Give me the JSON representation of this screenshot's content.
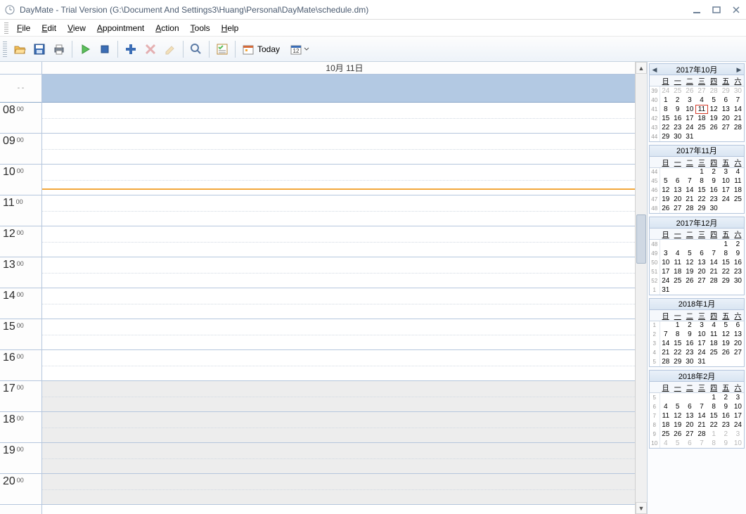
{
  "window": {
    "title": "DayMate - Trial Version (G:\\Document And Settings3\\Huang\\Personal\\DayMate\\schedule.dm)"
  },
  "menu": {
    "items": [
      "File",
      "Edit",
      "View",
      "Appointment",
      "Action",
      "Tools",
      "Help"
    ]
  },
  "toolbar": {
    "today_label": "Today"
  },
  "schedule": {
    "date_header": "10月 11日",
    "hours": [
      "08",
      "09",
      "10",
      "11",
      "12",
      "13",
      "14",
      "15",
      "16",
      "17",
      "18",
      "19",
      "20"
    ],
    "minute_label": "00",
    "shade_after_index": 9
  },
  "dow_labels": [
    "日",
    "一",
    "二",
    "三",
    "四",
    "五",
    "六"
  ],
  "calendars": [
    {
      "title": "2017年10月",
      "has_nav": true,
      "week_nums": [
        "39",
        "40",
        "41",
        "42",
        "43",
        "44"
      ],
      "rows": [
        [
          {
            "d": "24",
            "dim": true
          },
          {
            "d": "25",
            "dim": true
          },
          {
            "d": "26",
            "dim": true
          },
          {
            "d": "27",
            "dim": true
          },
          {
            "d": "28",
            "dim": true
          },
          {
            "d": "29",
            "dim": true
          },
          {
            "d": "30",
            "dim": true
          }
        ],
        [
          {
            "d": "1"
          },
          {
            "d": "2"
          },
          {
            "d": "3"
          },
          {
            "d": "4"
          },
          {
            "d": "5"
          },
          {
            "d": "6"
          },
          {
            "d": "7"
          }
        ],
        [
          {
            "d": "8"
          },
          {
            "d": "9"
          },
          {
            "d": "10"
          },
          {
            "d": "11",
            "today": true
          },
          {
            "d": "12"
          },
          {
            "d": "13"
          },
          {
            "d": "14"
          }
        ],
        [
          {
            "d": "15"
          },
          {
            "d": "16"
          },
          {
            "d": "17"
          },
          {
            "d": "18"
          },
          {
            "d": "19"
          },
          {
            "d": "20"
          },
          {
            "d": "21"
          }
        ],
        [
          {
            "d": "22"
          },
          {
            "d": "23"
          },
          {
            "d": "24"
          },
          {
            "d": "25"
          },
          {
            "d": "26"
          },
          {
            "d": "27"
          },
          {
            "d": "28"
          }
        ],
        [
          {
            "d": "29"
          },
          {
            "d": "30"
          },
          {
            "d": "31"
          },
          {
            "d": ""
          },
          {
            "d": ""
          },
          {
            "d": ""
          },
          {
            "d": ""
          }
        ]
      ]
    },
    {
      "title": "2017年11月",
      "has_nav": false,
      "week_nums": [
        "44",
        "45",
        "46",
        "47",
        "48"
      ],
      "rows": [
        [
          {
            "d": ""
          },
          {
            "d": ""
          },
          {
            "d": ""
          },
          {
            "d": "1"
          },
          {
            "d": "2"
          },
          {
            "d": "3"
          },
          {
            "d": "4"
          }
        ],
        [
          {
            "d": "5"
          },
          {
            "d": "6"
          },
          {
            "d": "7"
          },
          {
            "d": "8"
          },
          {
            "d": "9"
          },
          {
            "d": "10"
          },
          {
            "d": "11"
          }
        ],
        [
          {
            "d": "12"
          },
          {
            "d": "13"
          },
          {
            "d": "14"
          },
          {
            "d": "15"
          },
          {
            "d": "16"
          },
          {
            "d": "17"
          },
          {
            "d": "18"
          }
        ],
        [
          {
            "d": "19"
          },
          {
            "d": "20"
          },
          {
            "d": "21"
          },
          {
            "d": "22"
          },
          {
            "d": "23"
          },
          {
            "d": "24"
          },
          {
            "d": "25"
          }
        ],
        [
          {
            "d": "26"
          },
          {
            "d": "27"
          },
          {
            "d": "28"
          },
          {
            "d": "29"
          },
          {
            "d": "30"
          },
          {
            "d": ""
          },
          {
            "d": ""
          }
        ]
      ]
    },
    {
      "title": "2017年12月",
      "has_nav": false,
      "week_nums": [
        "48",
        "49",
        "50",
        "51",
        "52",
        "1"
      ],
      "rows": [
        [
          {
            "d": ""
          },
          {
            "d": ""
          },
          {
            "d": ""
          },
          {
            "d": ""
          },
          {
            "d": ""
          },
          {
            "d": "1"
          },
          {
            "d": "2"
          }
        ],
        [
          {
            "d": "3"
          },
          {
            "d": "4"
          },
          {
            "d": "5"
          },
          {
            "d": "6"
          },
          {
            "d": "7"
          },
          {
            "d": "8"
          },
          {
            "d": "9"
          }
        ],
        [
          {
            "d": "10"
          },
          {
            "d": "11"
          },
          {
            "d": "12"
          },
          {
            "d": "13"
          },
          {
            "d": "14"
          },
          {
            "d": "15"
          },
          {
            "d": "16"
          }
        ],
        [
          {
            "d": "17"
          },
          {
            "d": "18"
          },
          {
            "d": "19"
          },
          {
            "d": "20"
          },
          {
            "d": "21"
          },
          {
            "d": "22"
          },
          {
            "d": "23"
          }
        ],
        [
          {
            "d": "24"
          },
          {
            "d": "25"
          },
          {
            "d": "26"
          },
          {
            "d": "27"
          },
          {
            "d": "28"
          },
          {
            "d": "29"
          },
          {
            "d": "30"
          }
        ],
        [
          {
            "d": "31"
          },
          {
            "d": ""
          },
          {
            "d": ""
          },
          {
            "d": ""
          },
          {
            "d": ""
          },
          {
            "d": ""
          },
          {
            "d": ""
          }
        ]
      ]
    },
    {
      "title": "2018年1月",
      "has_nav": false,
      "week_nums": [
        "1",
        "2",
        "3",
        "4",
        "5"
      ],
      "rows": [
        [
          {
            "d": ""
          },
          {
            "d": "1"
          },
          {
            "d": "2"
          },
          {
            "d": "3"
          },
          {
            "d": "4"
          },
          {
            "d": "5"
          },
          {
            "d": "6"
          }
        ],
        [
          {
            "d": "7"
          },
          {
            "d": "8"
          },
          {
            "d": "9"
          },
          {
            "d": "10"
          },
          {
            "d": "11"
          },
          {
            "d": "12"
          },
          {
            "d": "13"
          }
        ],
        [
          {
            "d": "14"
          },
          {
            "d": "15"
          },
          {
            "d": "16"
          },
          {
            "d": "17"
          },
          {
            "d": "18"
          },
          {
            "d": "19"
          },
          {
            "d": "20"
          }
        ],
        [
          {
            "d": "21"
          },
          {
            "d": "22"
          },
          {
            "d": "23"
          },
          {
            "d": "24"
          },
          {
            "d": "25"
          },
          {
            "d": "26"
          },
          {
            "d": "27"
          }
        ],
        [
          {
            "d": "28"
          },
          {
            "d": "29"
          },
          {
            "d": "30"
          },
          {
            "d": "31"
          },
          {
            "d": ""
          },
          {
            "d": ""
          },
          {
            "d": ""
          }
        ]
      ]
    },
    {
      "title": "2018年2月",
      "has_nav": false,
      "week_nums": [
        "5",
        "6",
        "7",
        "8",
        "9",
        "10"
      ],
      "rows": [
        [
          {
            "d": ""
          },
          {
            "d": ""
          },
          {
            "d": ""
          },
          {
            "d": ""
          },
          {
            "d": "1"
          },
          {
            "d": "2"
          },
          {
            "d": "3"
          }
        ],
        [
          {
            "d": "4"
          },
          {
            "d": "5"
          },
          {
            "d": "6"
          },
          {
            "d": "7"
          },
          {
            "d": "8"
          },
          {
            "d": "9"
          },
          {
            "d": "10"
          }
        ],
        [
          {
            "d": "11"
          },
          {
            "d": "12"
          },
          {
            "d": "13"
          },
          {
            "d": "14"
          },
          {
            "d": "15"
          },
          {
            "d": "16"
          },
          {
            "d": "17"
          }
        ],
        [
          {
            "d": "18"
          },
          {
            "d": "19"
          },
          {
            "d": "20"
          },
          {
            "d": "21"
          },
          {
            "d": "22"
          },
          {
            "d": "23"
          },
          {
            "d": "24"
          }
        ],
        [
          {
            "d": "25"
          },
          {
            "d": "26"
          },
          {
            "d": "27"
          },
          {
            "d": "28"
          },
          {
            "d": "1",
            "dim": true
          },
          {
            "d": "2",
            "dim": true
          },
          {
            "d": "3",
            "dim": true
          }
        ],
        [
          {
            "d": "4",
            "dim": true
          },
          {
            "d": "5",
            "dim": true
          },
          {
            "d": "6",
            "dim": true
          },
          {
            "d": "7",
            "dim": true
          },
          {
            "d": "8",
            "dim": true
          },
          {
            "d": "9",
            "dim": true
          },
          {
            "d": "10",
            "dim": true
          }
        ]
      ]
    }
  ]
}
